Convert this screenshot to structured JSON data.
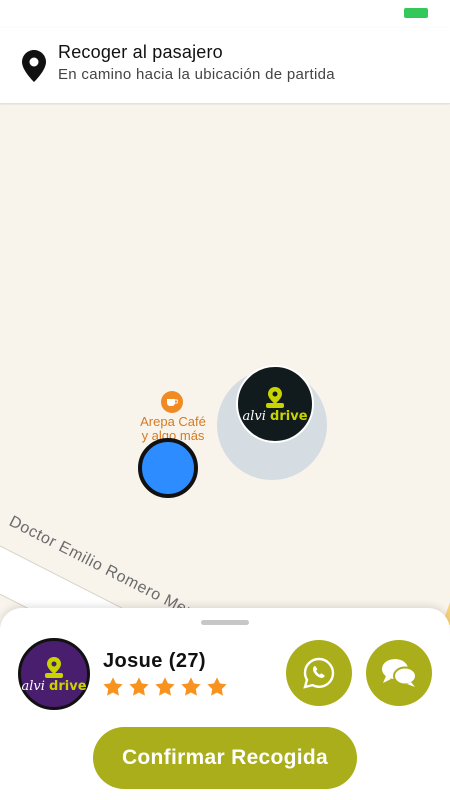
{
  "header": {
    "title": "Recoger al pasajero",
    "subtitle": "En camino hacia la ubicación de partida",
    "icon": "location-pin-icon"
  },
  "map": {
    "road_name": "Doctor Emilio Romero Mené",
    "poi": {
      "name_line1": "Arepa Café",
      "name_line2": "y algo más",
      "icon": "cafe-icon"
    },
    "driver_marker_logo": {
      "brand_a": "alvi",
      "brand_b": "drive"
    }
  },
  "passenger": {
    "name": "Josue (27)",
    "rating": 5,
    "avatar_logo": {
      "brand_a": "alvi",
      "brand_b": "drive"
    }
  },
  "actions": {
    "whatsapp_icon": "whatsapp-icon",
    "chat_icon": "chat-icon",
    "confirm_label": "Confirmar Recogida"
  },
  "colors": {
    "accent": "#a9ae1a",
    "user_dot": "#2d8cff",
    "star": "#f7931e",
    "battery": "#34c759"
  }
}
